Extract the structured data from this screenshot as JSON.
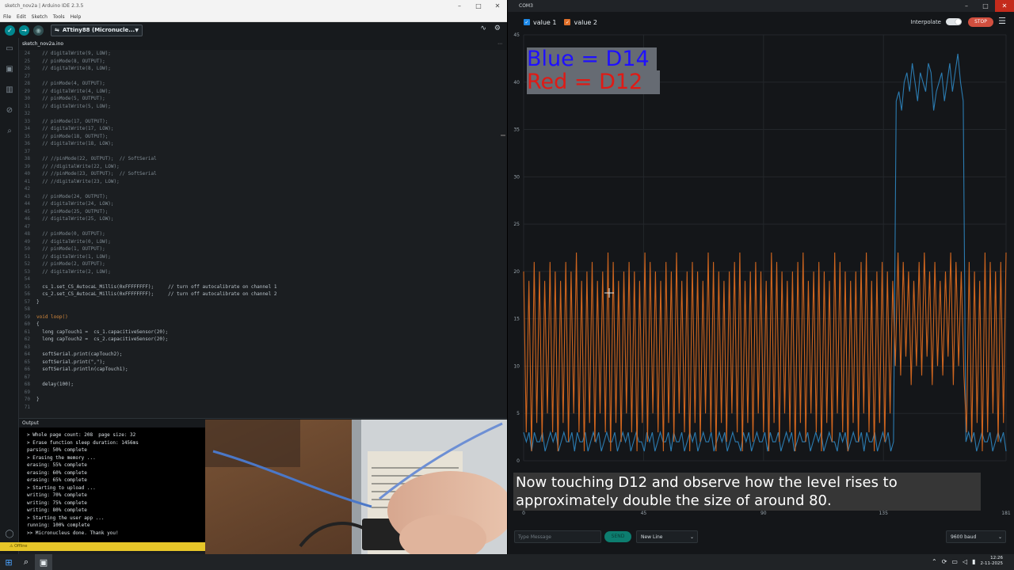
{
  "ide": {
    "window_title": "sketch_nov2a | Arduino IDE 2.3.5",
    "menu": [
      "File",
      "Edit",
      "Sketch",
      "Tools",
      "Help"
    ],
    "board": "ATtiny88 (Micronucle...",
    "tab": "sketch_nov2a.ino",
    "code_lines": [
      {
        "n": "24",
        "t": "  // digitalWrite(9, LOW);"
      },
      {
        "n": "25",
        "t": "  // pinMode(8, OUTPUT);"
      },
      {
        "n": "26",
        "t": "  // digitalWrite(8, LOW);"
      },
      {
        "n": "27",
        "t": ""
      },
      {
        "n": "28",
        "t": "  // pinMode(4, OUTPUT);"
      },
      {
        "n": "29",
        "t": "  // digitalWrite(4, LOW);"
      },
      {
        "n": "30",
        "t": "  // pinMode(5, OUTPUT);"
      },
      {
        "n": "31",
        "t": "  // digitalWrite(5, LOW);"
      },
      {
        "n": "32",
        "t": ""
      },
      {
        "n": "33",
        "t": "  // pinMode(17, OUTPUT);"
      },
      {
        "n": "34",
        "t": "  // digitalWrite(17, LOW);"
      },
      {
        "n": "35",
        "t": "  // pinMode(18, OUTPUT);"
      },
      {
        "n": "36",
        "t": "  // digitalWrite(18, LOW);"
      },
      {
        "n": "37",
        "t": ""
      },
      {
        "n": "38",
        "t": "  // //pinMode(22, OUTPUT);  // SoftSerial"
      },
      {
        "n": "39",
        "t": "  // //digitalWrite(22, LOW);"
      },
      {
        "n": "40",
        "t": "  // //pinMode(23, OUTPUT);  // SoftSerial"
      },
      {
        "n": "41",
        "t": "  // //digitalWrite(23, LOW);"
      },
      {
        "n": "42",
        "t": ""
      },
      {
        "n": "43",
        "t": "  // pinMode(24, OUTPUT);"
      },
      {
        "n": "44",
        "t": "  // digitalWrite(24, LOW);"
      },
      {
        "n": "45",
        "t": "  // pinMode(25, OUTPUT);"
      },
      {
        "n": "46",
        "t": "  // digitalWrite(25, LOW);"
      },
      {
        "n": "47",
        "t": ""
      },
      {
        "n": "48",
        "t": "  // pinMode(0, OUTPUT);"
      },
      {
        "n": "49",
        "t": "  // digitalWrite(0, LOW);"
      },
      {
        "n": "50",
        "t": "  // pinMode(1, OUTPUT);"
      },
      {
        "n": "51",
        "t": "  // digitalWrite(1, LOW);"
      },
      {
        "n": "52",
        "t": "  // pinMode(2, OUTPUT);"
      },
      {
        "n": "53",
        "t": "  // digitalWrite(2, LOW);"
      },
      {
        "n": "54",
        "t": ""
      },
      {
        "n": "55",
        "t": "  cs_1.set_CS_AutocaL_Millis(0xFFFFFFFF);     // turn off autocalibrate on channel 1",
        "a": true
      },
      {
        "n": "56",
        "t": "  cs_2.set_CS_AutocaL_Millis(0xFFFFFFFF);     // turn off autocalibrate on channel 2",
        "a": true
      },
      {
        "n": "57",
        "t": "}",
        "a": true
      },
      {
        "n": "58",
        "t": ""
      },
      {
        "n": "59",
        "t": "void loop()",
        "a": true
      },
      {
        "n": "60",
        "t": "{",
        "a": true
      },
      {
        "n": "61",
        "t": "  long capTouch1 =  cs_1.capacitiveSensor(20);",
        "a": true
      },
      {
        "n": "62",
        "t": "  long capTouch2 =  cs_2.capacitiveSensor(20);",
        "a": true
      },
      {
        "n": "63",
        "t": ""
      },
      {
        "n": "64",
        "t": "  softSerial.print(capTouch2);",
        "a": true
      },
      {
        "n": "65",
        "t": "  softSerial.print(\",\");",
        "a": true
      },
      {
        "n": "66",
        "t": "  softSerial.println(capTouch1);",
        "a": true
      },
      {
        "n": "67",
        "t": ""
      },
      {
        "n": "68",
        "t": "  delay(100);",
        "a": true
      },
      {
        "n": "69",
        "t": ""
      },
      {
        "n": "70",
        "t": "}",
        "a": true
      },
      {
        "n": "71",
        "t": ""
      }
    ],
    "output_title": "Output",
    "output_lines": [
      "> Whole page count: 208  page size: 32",
      "> Erase function sleep duration: 1456ms",
      "parsing: 50% complete",
      "> Erasing the memory ...",
      "erasing: 55% complete",
      "erasing: 60% complete",
      "erasing: 65% complete",
      "> Starting to upload ...",
      "writing: 70% complete",
      "writing: 75% complete",
      "writing: 80% complete",
      "> Starting the user app ...",
      "running: 100% complete",
      ">> Micronucleus done. Thank you!"
    ],
    "status": "Offline"
  },
  "serial": {
    "window_title": "COM3",
    "legend": [
      {
        "label": "value 1",
        "color": "#1e88e5"
      },
      {
        "label": "value 2",
        "color": "#e0702a"
      }
    ],
    "interpolate_label": "Interpolate",
    "stop_label": "STOP",
    "overlay_blue": "Blue = D14",
    "overlay_red": "Red  = D12",
    "caption": "Now touching D12 and observe how the level rises to approximately double the size of around 80.",
    "message_placeholder": "Type Message",
    "send_label": "SEND",
    "line_ending": "New Line",
    "baud": "9600 baud"
  },
  "chart_data": {
    "type": "line",
    "ylim": [
      0,
      45
    ],
    "yticks": [
      "0",
      "5",
      "10",
      "15",
      "20",
      "25",
      "30",
      "35",
      "40",
      "45"
    ],
    "xticks": [
      "0",
      "45",
      "90",
      "135",
      "181"
    ],
    "xlim": [
      0,
      181
    ],
    "series": [
      {
        "name": "value 1",
        "color": "#2e86c1",
        "values": [
          3,
          2,
          3,
          1,
          3,
          2,
          2,
          3,
          1,
          2,
          3,
          2,
          3,
          1,
          2,
          3,
          2,
          2,
          3,
          1,
          3,
          2,
          2,
          3,
          1,
          2,
          3,
          2,
          3,
          1,
          2,
          3,
          2,
          2,
          3,
          1,
          2,
          3,
          2,
          3,
          1,
          2,
          3,
          2,
          2,
          1,
          3,
          2,
          3,
          1,
          2,
          3,
          2,
          2,
          3,
          1,
          3,
          2,
          2,
          3,
          1,
          2,
          3,
          2,
          3,
          1,
          2,
          3,
          2,
          2,
          3,
          1,
          2,
          3,
          2,
          3,
          1,
          2,
          3,
          2,
          2,
          1,
          3,
          2,
          3,
          1,
          2,
          3,
          2,
          2,
          3,
          1,
          3,
          2,
          2,
          3,
          1,
          2,
          3,
          2,
          3,
          1,
          2,
          3,
          2,
          2,
          3,
          1,
          2,
          3,
          2,
          3,
          1,
          2,
          3,
          2,
          2,
          1,
          3,
          2,
          3,
          1,
          2,
          3,
          2,
          2,
          3,
          1,
          3,
          2,
          2,
          3,
          1,
          2,
          3,
          2,
          3,
          1,
          2,
          38,
          39,
          37,
          40,
          41,
          39,
          42,
          40,
          38,
          41,
          40,
          39,
          42,
          41,
          37,
          39,
          40,
          41,
          38,
          40,
          42,
          39,
          41,
          43,
          40,
          38,
          2,
          3,
          2,
          3,
          1,
          2,
          3,
          2,
          2,
          3,
          1,
          2,
          3,
          2,
          3,
          1
        ]
      },
      {
        "name": "value 2",
        "color": "#d9691f",
        "values": [
          20,
          3,
          19,
          1,
          21,
          4,
          20,
          2,
          19,
          5,
          21,
          3,
          20,
          1,
          19,
          4,
          21,
          2,
          20,
          5,
          22,
          3,
          19,
          1,
          20,
          4,
          21,
          2,
          19,
          5,
          20,
          3,
          22,
          1,
          21,
          4,
          19,
          2,
          20,
          5,
          21,
          3,
          20,
          1,
          19,
          4,
          22,
          2,
          21,
          5,
          20,
          3,
          19,
          1,
          21,
          4,
          20,
          2,
          22,
          5,
          19,
          3,
          20,
          1,
          21,
          4,
          20,
          2,
          19,
          5,
          22,
          3,
          21,
          1,
          20,
          4,
          19,
          2,
          20,
          5,
          21,
          3,
          22,
          1,
          19,
          4,
          20,
          2,
          21,
          5,
          20,
          3,
          19,
          1,
          22,
          4,
          21,
          2,
          20,
          5,
          19,
          3,
          20,
          1,
          21,
          4,
          22,
          2,
          19,
          5,
          20,
          3,
          21,
          1,
          20,
          4,
          19,
          2,
          22,
          5,
          21,
          3,
          20,
          1,
          19,
          4,
          20,
          2,
          21,
          5,
          22,
          3,
          19,
          1,
          20,
          4,
          21,
          2,
          20,
          5,
          19,
          10,
          22,
          9,
          21,
          11,
          20,
          8,
          19,
          10,
          21,
          9,
          22,
          11,
          20,
          8,
          21,
          10,
          19,
          9,
          20,
          11,
          22,
          8,
          21,
          10,
          20,
          9,
          3,
          21,
          2,
          20,
          4,
          19,
          1,
          22,
          3,
          21,
          5,
          20,
          2,
          21,
          4,
          22
        ]
      }
    ]
  }
}
